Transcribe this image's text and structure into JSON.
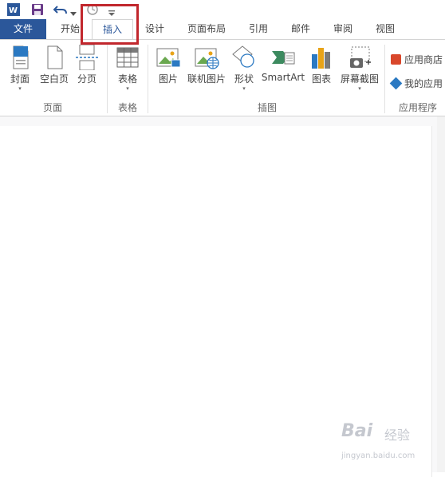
{
  "colors": {
    "file_tab_bg": "#2b579a",
    "highlight_box": "#c1272d",
    "accent": "#2b579a"
  },
  "quick_access": {
    "icons": [
      "word-app-icon",
      "save-icon",
      "undo-icon",
      "undo-dropdown-icon",
      "clock-icon",
      "customize-dropdown-icon"
    ]
  },
  "tabs": [
    {
      "label": "文件",
      "name": "file"
    },
    {
      "label": "开始",
      "name": "home"
    },
    {
      "label": "插入",
      "name": "insert"
    },
    {
      "label": "设计",
      "name": "design"
    },
    {
      "label": "页面布局",
      "name": "page-layout"
    },
    {
      "label": "引用",
      "name": "references"
    },
    {
      "label": "邮件",
      "name": "mailings"
    },
    {
      "label": "审阅",
      "name": "review"
    },
    {
      "label": "视图",
      "name": "view"
    }
  ],
  "active_tab": "插入",
  "ribbon": {
    "groups": {
      "pages": "页面",
      "tables": "表格",
      "illustrations": "插图",
      "apps": "应用程序"
    },
    "buttons": {
      "cover": "封面",
      "blank_page": "空白页",
      "page_break": "分页",
      "table": "表格",
      "picture": "图片",
      "online_picture": "联机图片",
      "shapes": "形状",
      "smartart": "SmartArt",
      "chart": "图表",
      "screenshot": "屏幕截图",
      "app_store": "应用商店",
      "my_apps": "我的应用"
    }
  },
  "watermark": {
    "brand": "Bai",
    "jing": "经验",
    "url": "jingyan.baidu.com"
  }
}
